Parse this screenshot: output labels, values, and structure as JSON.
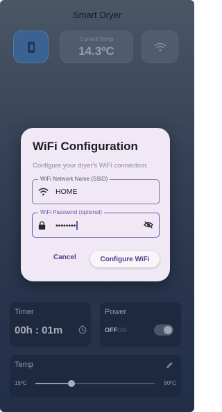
{
  "app": {
    "title": "Smart Dryer"
  },
  "status_tiles": {
    "current_temp_label": "Current Temp",
    "current_temp_value": "14.3ºC"
  },
  "timer": {
    "title": "Timer",
    "value": "00h : 01m"
  },
  "power": {
    "title": "Power",
    "off_label": "OFF",
    "on_label": "ON",
    "is_on": false
  },
  "temp_control": {
    "title": "Temp",
    "min_label": "15ºC",
    "max_label": "80ºC",
    "slider_fraction": 0.3
  },
  "dialog": {
    "title": "WiFi Configuration",
    "subtitle": "Configure your dryer's WiFi connection:",
    "ssid_label": "WiFi Network Name (SSID)",
    "ssid_value": "HOME",
    "password_label": "WiFi Password (optional)",
    "password_masked": "••••••••",
    "cancel_label": "Cancel",
    "configure_label": "Configure WiFi"
  },
  "colors": {
    "accent": "#6a57a8",
    "dialog_bg": "#f0e9f5",
    "device_tile": "#4a7fb8"
  },
  "icons": [
    "dryer-icon",
    "wifi-icon",
    "timer-icon",
    "edit-icon",
    "lock-icon",
    "visibility-off-icon"
  ]
}
